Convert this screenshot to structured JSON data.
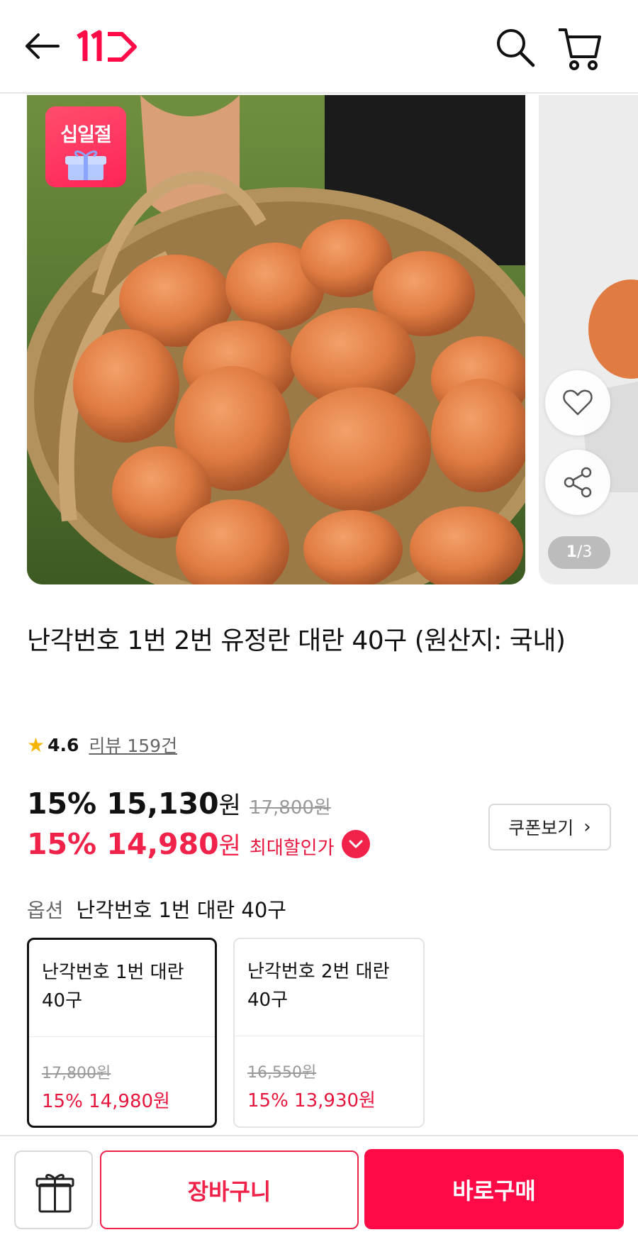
{
  "header": {
    "back_icon": "arrow-left-icon",
    "logo_icon": "11st-logo",
    "search_icon": "search-icon",
    "cart_icon": "cart-icon",
    "brand_color": "#ff0a47"
  },
  "gallery": {
    "badge_text": "십일절",
    "pager_current": "1",
    "pager_total": "/3",
    "wish_icon": "heart-icon",
    "share_icon": "share-icon"
  },
  "product": {
    "title": "난각번호 1번 2번 유정란 대란 40구 (원산지: 국내)",
    "rating_value": "4.6",
    "review_text": "리뷰 159건",
    "price": {
      "sale_pct": "15%",
      "sale_price": "15,130",
      "won": "원",
      "original": "17,800원",
      "max_pct": "15%",
      "max_price": "14,980",
      "max_label": "최대할인가"
    },
    "coupon_label": "쿠폰보기"
  },
  "option": {
    "label": "옵션",
    "selected_value": "난각번호 1번 대란 40구",
    "cards": [
      {
        "name": "난각번호 1번 대란 40구",
        "original": "17,800원",
        "price": "15% 14,980원",
        "selected": true
      },
      {
        "name": "난각번호 2번 대란 40구",
        "original": "16,550원",
        "price": "15% 13,930원",
        "selected": false
      }
    ]
  },
  "bottom_bar": {
    "gift_icon": "gift-icon",
    "cart_label": "장바구니",
    "buy_label": "바로구매"
  }
}
